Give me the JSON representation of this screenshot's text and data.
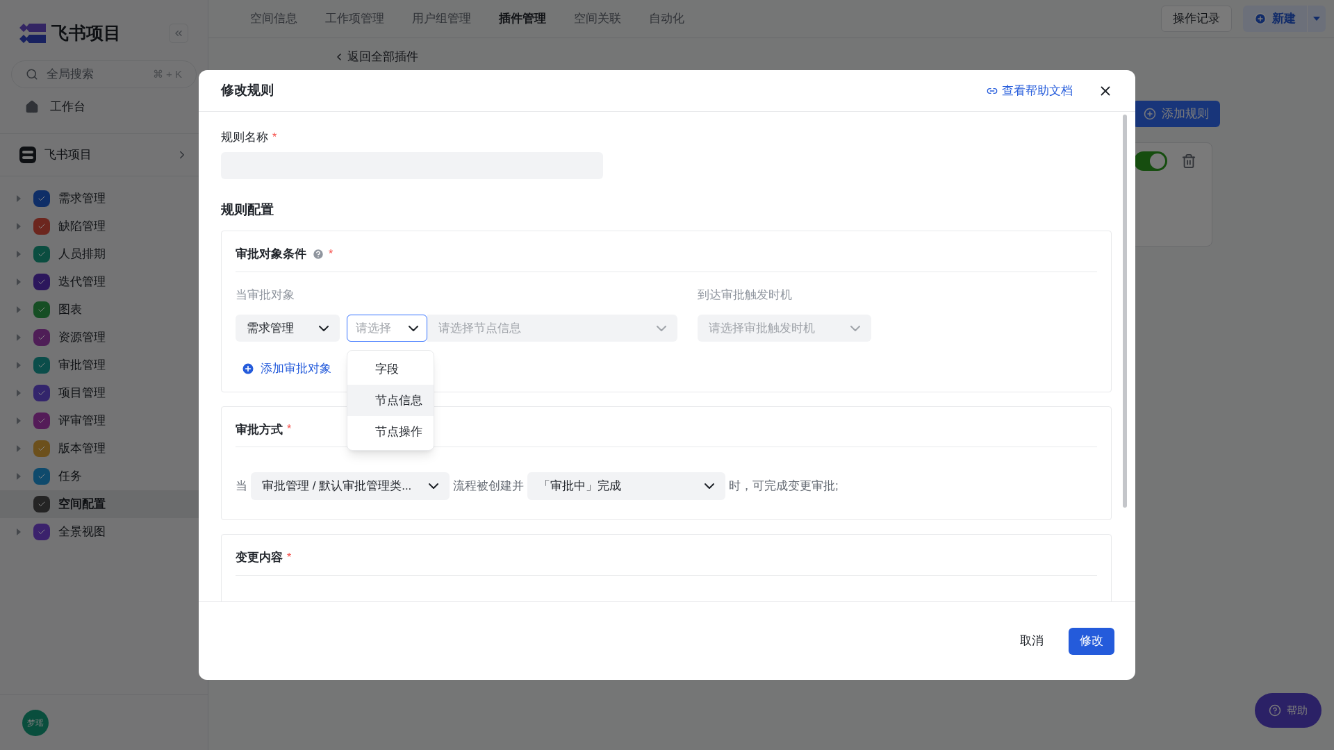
{
  "sidebar": {
    "logo_text": "飞书项目",
    "search": {
      "placeholder": "全局搜索",
      "shortcut": "⌘ + K"
    },
    "workbench": "工作台",
    "space": {
      "name": "飞书项目"
    },
    "items": [
      {
        "label": "需求管理",
        "color": "#0f2e67",
        "expandable": true,
        "selected": false
      },
      {
        "label": "缺陷管理",
        "color": "#6c261e",
        "expandable": true,
        "selected": false
      },
      {
        "label": "人员排期",
        "color": "#0b4d40",
        "expandable": true,
        "selected": false
      },
      {
        "label": "迭代管理",
        "color": "#2c175c",
        "expandable": true,
        "selected": false
      },
      {
        "label": "图表",
        "color": "#164e24",
        "expandable": true,
        "selected": false
      },
      {
        "label": "资源管理",
        "color": "#4f1e57",
        "expandable": true,
        "selected": false
      },
      {
        "label": "审批管理",
        "color": "#0b4d4a",
        "expandable": true,
        "selected": false
      },
      {
        "label": "项目管理",
        "color": "#33256c",
        "expandable": true,
        "selected": false
      },
      {
        "label": "评审管理",
        "color": "#541c58",
        "expandable": true,
        "selected": false
      },
      {
        "label": "版本管理",
        "color": "#6c501c",
        "expandable": true,
        "selected": false
      },
      {
        "label": "任务",
        "color": "#0f4a6c",
        "expandable": true,
        "selected": false
      },
      {
        "label": "空间配置",
        "color": "#242424",
        "expandable": false,
        "selected": true
      },
      {
        "label": "全景视图",
        "color": "#3b226c",
        "expandable": true,
        "selected": false
      }
    ],
    "avatar": "梦瑶"
  },
  "top_nav": {
    "tabs": [
      {
        "label": "空间信息",
        "selected": false
      },
      {
        "label": "工作项管理",
        "selected": false
      },
      {
        "label": "用户组管理",
        "selected": false
      },
      {
        "label": "插件管理",
        "selected": true
      },
      {
        "label": "空间关联",
        "selected": false
      },
      {
        "label": "自动化",
        "selected": false
      }
    ],
    "history_button": "操作记录",
    "new_button": "新建"
  },
  "page": {
    "back_link": "返回全部插件",
    "add_rule_button": "添加规则",
    "rule_enabled": true
  },
  "help_button": "帮助",
  "modal": {
    "title": "修改规则",
    "help_link": "查看帮助文档",
    "name_field": {
      "label": "规则名称",
      "required_mark": "*"
    },
    "config_title": "规则配置",
    "object_condition": {
      "title": "审批对象条件",
      "required_mark": "*",
      "object_label": "当审批对象",
      "trigger_label": "到达审批触发时机",
      "object_select": "需求管理",
      "type_select": {
        "placeholder": "请选择",
        "focused": true
      },
      "node_select": {
        "placeholder": "请选择节点信息"
      },
      "trigger_select": {
        "placeholder": "请选择审批触发时机"
      },
      "add_object": "添加审批对象",
      "dropdown": [
        {
          "label": "字段",
          "selected": false
        },
        {
          "label": "节点信息",
          "selected": true
        },
        {
          "label": "节点操作",
          "selected": false
        }
      ]
    },
    "method": {
      "title": "审批方式",
      "required_mark": "*",
      "prefix": "当",
      "flow_select": "审批管理 / 默认审批管理类...",
      "middle": "流程被创建并",
      "state_select": "「审批中」完成",
      "suffix": "时，可完成变更审批;"
    },
    "change": {
      "title": "变更内容",
      "required_mark": "*"
    },
    "footer": {
      "cancel": "取消",
      "submit": "修改"
    }
  }
}
